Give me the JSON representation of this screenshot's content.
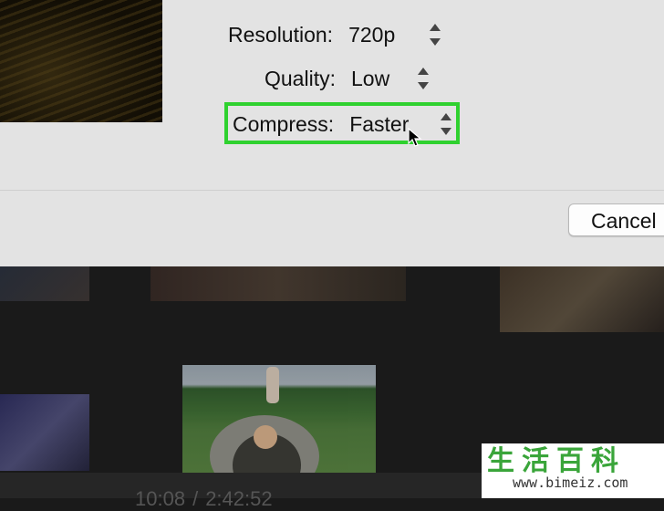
{
  "dialog": {
    "settings": [
      {
        "label": "Resolution:",
        "value": "720p"
      },
      {
        "label": "Quality:",
        "value": "Low"
      },
      {
        "label": "Compress:",
        "value": "Faster"
      }
    ],
    "cancel_label": "Cancel"
  },
  "timeline": {
    "current_time": "10:08",
    "separator": "/",
    "total_time": "2:42:52"
  },
  "watermark": {
    "title": "生活百科",
    "url": "www.bimeiz.com"
  },
  "colors": {
    "highlight": "#2fd12f",
    "sheet_bg": "#e3e3e3",
    "app_bg": "#1a1a1a"
  }
}
